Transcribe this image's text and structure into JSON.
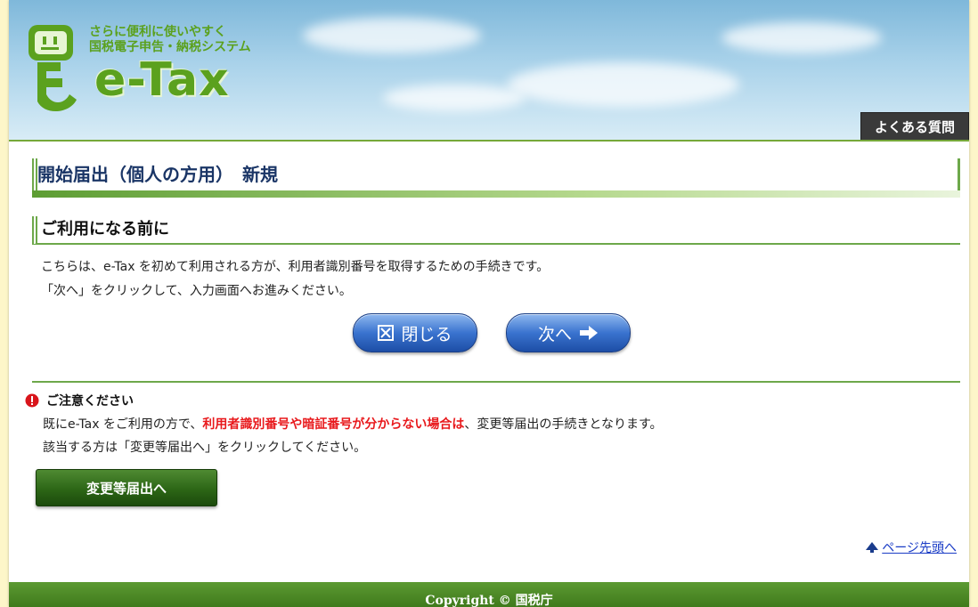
{
  "header": {
    "tagline_line1": "さらに便利に使いやすく",
    "tagline_line2": "国税電子申告・納税システム",
    "logo_text": "e-Tax",
    "faq_label": "よくある質問"
  },
  "page_title": "開始届出（個人の方用）　新規",
  "section_heading": "ご利用になる前に",
  "intro": {
    "line1": "こちらは、e-Tax を初めて利用される方が、利用者識別番号を取得するための手続きです。",
    "line2": "「次へ」をクリックして、入力画面へお進みください。"
  },
  "buttons": {
    "close_label": "閉じる",
    "next_label": "次へ",
    "change_label": "変更等届出へ"
  },
  "notice": {
    "title": "ご注意ください",
    "line1_prefix": "既にe-Tax をご利用の方で、",
    "line1_highlight": "利用者識別番号や暗証番号が分からない場合は",
    "line1_suffix": "、変更等届出の手続きとなります。",
    "line2": "該当する方は「変更等届出へ」をクリックしてください。"
  },
  "page_top_link": "ページ先頭へ",
  "footer": "Copyright © 国税庁",
  "colors": {
    "brand_green": "#5ba11e",
    "title_navy": "#1a3566",
    "button_blue": "#3a73cf",
    "warning_red": "#e8191c"
  }
}
